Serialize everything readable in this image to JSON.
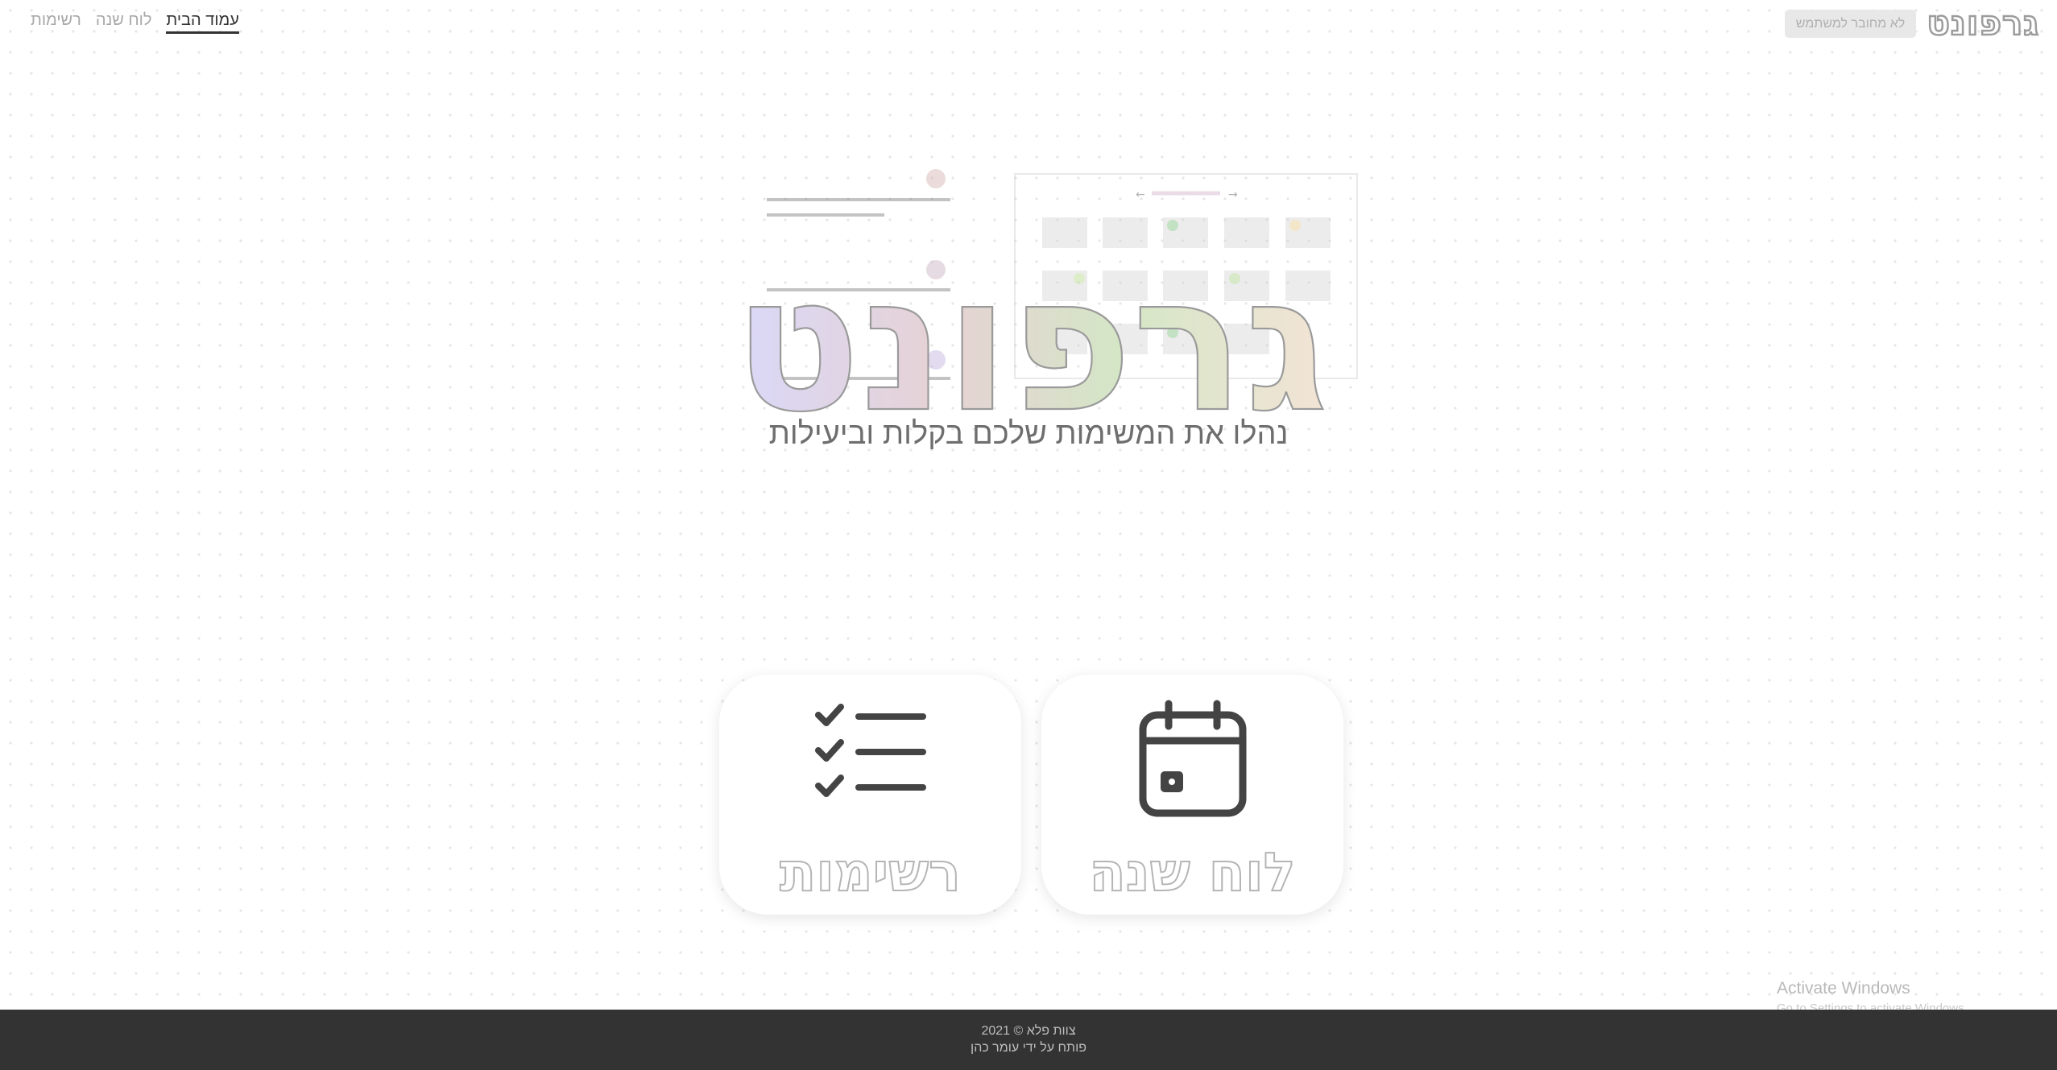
{
  "header": {
    "brand": "גרפונט",
    "user_status": "לא מחובר למשתמש",
    "nav": [
      {
        "label": "רשימות"
      },
      {
        "label": "לוח שנה"
      },
      {
        "label": "עמוד הבית",
        "active": true
      }
    ]
  },
  "hero": {
    "title": "גרפונט",
    "tagline": "נהלו את המשימות שלכם בקלות וביעילות"
  },
  "cards": {
    "lists": {
      "label": "רשימות",
      "icon": "checklist-icon"
    },
    "calendar": {
      "label": "לוח שנה",
      "icon": "calendar-icon"
    }
  },
  "watermark": {
    "title": "Activate Windows",
    "subtitle": "Go to Settings to activate Windows."
  },
  "footer": {
    "copyright": "צוות פלא © 2021",
    "credit": "פותח על ידי עומר כהן"
  },
  "colors": {
    "footer_bg": "#333333",
    "title_gradient": [
      "#dcdcf5",
      "#e8d6d6",
      "#d8e8c8",
      "#f2e4d4"
    ]
  }
}
